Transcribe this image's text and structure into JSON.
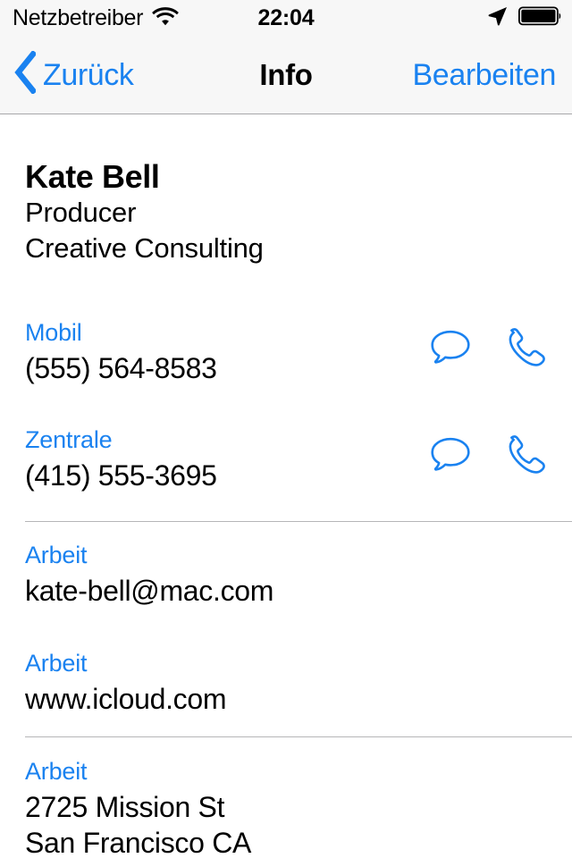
{
  "status_bar": {
    "carrier": "Netzbetreiber",
    "wifi_icon": "wifi-icon",
    "time": "22:04",
    "location_icon": "location-arrow-icon",
    "battery_icon": "battery-full-icon"
  },
  "nav_bar": {
    "back_icon": "chevron-left-icon",
    "back_label": "Zurück",
    "title": "Info",
    "edit_label": "Bearbeiten"
  },
  "contact": {
    "name": "Kate Bell",
    "job_title": "Producer",
    "organization": "Creative Consulting"
  },
  "fields": [
    {
      "label": "Mobil",
      "value": "(555) 564-8583",
      "message_icon": "message-bubble-icon",
      "call_icon": "phone-handset-icon"
    },
    {
      "label": "Zentrale",
      "value": "(415) 555-3695",
      "message_icon": "message-bubble-icon",
      "call_icon": "phone-handset-icon"
    },
    {
      "label": "Arbeit",
      "value": "kate-bell@mac.com"
    },
    {
      "label": "Arbeit",
      "value": "www.icloud.com"
    },
    {
      "label": "Arbeit",
      "value": "2725 Mission St",
      "value_line2": "San Francisco CA"
    }
  ],
  "colors": {
    "tint": "#1a82f0",
    "bar_background": "#f7f7f7",
    "separator": "#b6b6b8",
    "text": "#000000"
  }
}
